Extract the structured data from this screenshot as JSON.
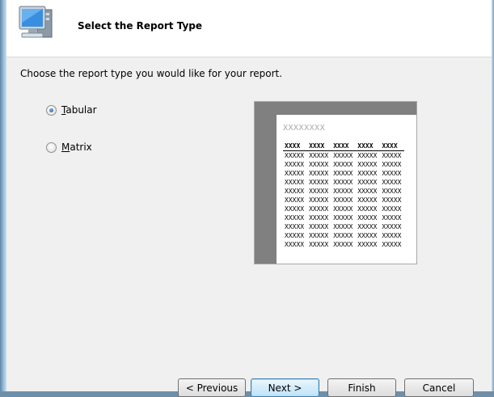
{
  "header": {
    "title": "Select the Report Type"
  },
  "main": {
    "prompt": "Choose the report type you would like for your report.",
    "options": [
      {
        "label_mnemonic": "T",
        "label_rest": "abular",
        "selected": true
      },
      {
        "label_mnemonic": "M",
        "label_rest": "atrix",
        "selected": false
      }
    ],
    "preview": {
      "title": "XXXXXXXX",
      "headers": [
        "XXXX",
        "XXXX",
        "XXXX",
        "XXXX",
        "XXXX"
      ],
      "rows": [
        [
          "XXXXX",
          "XXXXX",
          "XXXXX",
          "XXXXX",
          "XXXXX"
        ],
        [
          "XXXXX",
          "XXXXX",
          "XXXXX",
          "XXXXX",
          "XXXXX"
        ],
        [
          "XXXXX",
          "XXXXX",
          "XXXXX",
          "XXXXX",
          "XXXXX"
        ],
        [
          "XXXXX",
          "XXXXX",
          "XXXXX",
          "XXXXX",
          "XXXXX"
        ],
        [
          "XXXXX",
          "XXXXX",
          "XXXXX",
          "XXXXX",
          "XXXXX"
        ],
        [
          "XXXXX",
          "XXXXX",
          "XXXXX",
          "XXXXX",
          "XXXXX"
        ],
        [
          "XXXXX",
          "XXXXX",
          "XXXXX",
          "XXXXX",
          "XXXXX"
        ],
        [
          "XXXXX",
          "XXXXX",
          "XXXXX",
          "XXXXX",
          "XXXXX"
        ],
        [
          "XXXXX",
          "XXXXX",
          "XXXXX",
          "XXXXX",
          "XXXXX"
        ],
        [
          "XXXXX",
          "XXXXX",
          "XXXXX",
          "XXXXX",
          "XXXXX"
        ],
        [
          "XXXXX",
          "XXXXX",
          "XXXXX",
          "XXXXX",
          "XXXXX"
        ]
      ]
    }
  },
  "buttons": {
    "previous": "< Previous",
    "next": "Next >",
    "finish": "Finish",
    "cancel": "Cancel"
  },
  "icons": {
    "header": "computer-monitor-icon"
  },
  "colors": {
    "header_bg": "#ffffff",
    "content_bg": "#f0f0f0",
    "frame": "#9fc3dd"
  }
}
